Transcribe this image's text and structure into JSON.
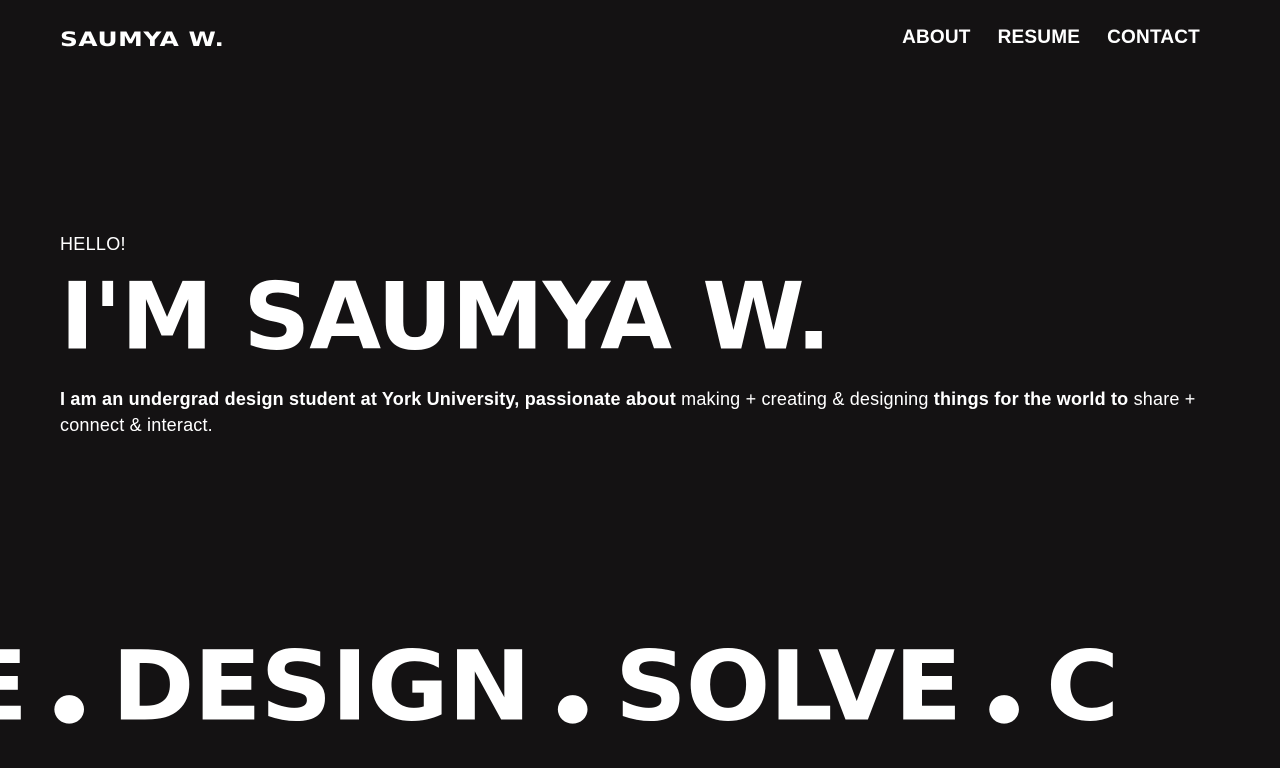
{
  "header": {
    "logo": "SAUMYA W.",
    "nav": [
      {
        "label": "ABOUT"
      },
      {
        "label": "RESUME"
      },
      {
        "label": "CONTACT"
      }
    ]
  },
  "hero": {
    "greeting": "HELLO!",
    "title": "I'M SAUMYA W.",
    "intro_parts": [
      {
        "text": "I am an undergrad design student at York University, passionate about",
        "style": "strong"
      },
      {
        "text": " making + creating & designing ",
        "style": "light"
      },
      {
        "text": "things for the world to",
        "style": "strong"
      },
      {
        "text": " share + connect & interact.",
        "style": "light"
      }
    ]
  },
  "marquee": {
    "words": [
      "E",
      "DESIGN",
      "SOLVE",
      "C"
    ]
  },
  "colors": {
    "background": "#141213",
    "text": "#ffffff"
  }
}
